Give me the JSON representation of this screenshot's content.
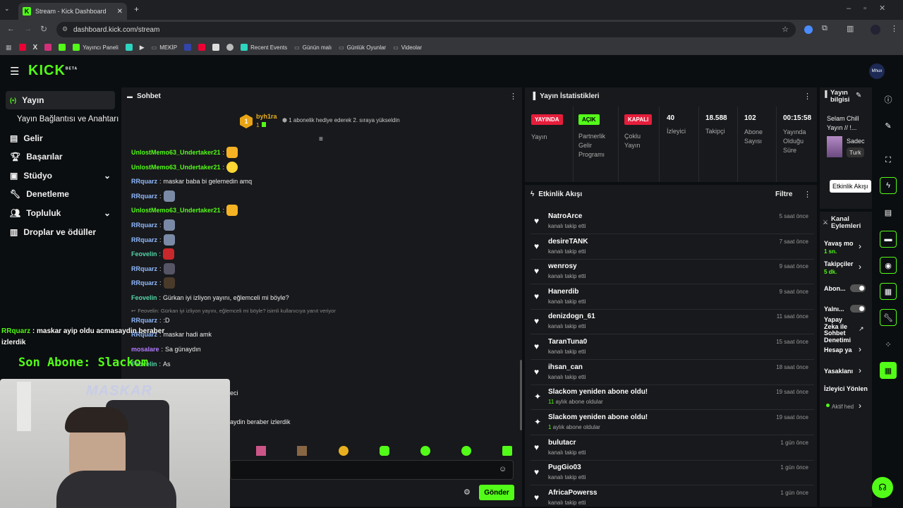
{
  "browser": {
    "tab_title": "Stream - Kick Dashboard",
    "url": "dashboard.kick.com/stream",
    "bookmarks": [
      "Yayıncı Paneli",
      "MEKİP",
      "Recent Events",
      "Günün malı",
      "Günlük Oyunlar",
      "Videolar"
    ]
  },
  "header": {
    "logo": "KICK",
    "logo_sup": "BETA",
    "avatar": "Mhux"
  },
  "sidebar": {
    "items": [
      {
        "label": "Yayın",
        "icon": "broadcast-icon"
      },
      {
        "label": "Yayın Bağlantısı ve Anahtarı",
        "icon": ""
      },
      {
        "label": "Gelir",
        "icon": "chart-icon"
      },
      {
        "label": "Başarılar",
        "icon": "trophy-icon"
      },
      {
        "label": "Stüdyo",
        "icon": "studio-icon"
      },
      {
        "label": "Denetleme",
        "icon": "wrench-icon"
      },
      {
        "label": "Topluluk",
        "icon": "people-icon"
      },
      {
        "label": "Droplar ve ödüller",
        "icon": "gift-icon"
      }
    ]
  },
  "overlay": {
    "chat_line_user": "RRquarz",
    "chat_line_text": " : maskar ayip oldu acmasaydin beraber izlerdik",
    "last_sub": "Son Abone: Slackom",
    "webcam_name": "MASKAR"
  },
  "chat": {
    "title": "Sohbet",
    "pinned_user": "byh1ra",
    "pinned_count": "1",
    "pinned_text": "1 abonelik hediye ederek 2. sıraya yükseldin",
    "messages": [
      {
        "user": "UnlostMemo63_Undertaker21",
        "text": "",
        "color": "green"
      },
      {
        "user": "UnlostMemo63_Undertaker21",
        "text": "",
        "color": "green"
      },
      {
        "user": "RRquarz",
        "text": "maskar baba bi gelemedin amq",
        "color": "blue"
      },
      {
        "user": "RRquarz",
        "text": "",
        "color": "blue"
      },
      {
        "user": "UnlostMemo63_Undertaker21",
        "text": "",
        "color": "green"
      },
      {
        "user": "RRquarz",
        "text": "",
        "color": "blue"
      },
      {
        "user": "RRquarz",
        "text": "",
        "color": "blue"
      },
      {
        "user": "Feovelin",
        "text": "",
        "color": "teal"
      },
      {
        "user": "RRquarz",
        "text": "",
        "color": "blue"
      },
      {
        "user": "RRquarz",
        "text": "",
        "color": "blue"
      },
      {
        "user": "Feovelin",
        "text": "Gürkan iyi izliyon yayını, eğlemceli mi böyle?",
        "color": "teal"
      }
    ],
    "reply_hint": "Feovelin: Gürkan iyi izliyon yayını, eğlemceli mi böyle? isimli kullanıcıya yanıt veriyor",
    "messages2": [
      {
        "user": "RRquarz",
        "text": ":D",
        "color": "blue"
      },
      {
        "user": "RRquarz",
        "text": "maskar hadi amk",
        "color": "blue"
      },
      {
        "user": "mosalare",
        "text": "Sa günaydın",
        "color": "purple"
      },
      {
        "user": "Feovelin",
        "text": "As",
        "color": "teal"
      }
    ],
    "partial1": "eci",
    "partial2": "aydin beraber izlerdik",
    "send_label": "Gönder"
  },
  "stats": {
    "title": "Yayın İstatistikleri",
    "items": [
      {
        "badge": "YAYINDA",
        "label": "Yayın",
        "color": "#e51d3b"
      },
      {
        "badge": "AÇIK",
        "label": "Partnerlik Gelir Programı",
        "color": "#53fc18"
      },
      {
        "badge": "KAPALI",
        "label": "Çoklu Yayın",
        "color": "#e51d3b"
      },
      {
        "value": "40",
        "label": "İzleyici"
      },
      {
        "value": "18.588",
        "label": "Takipçi"
      },
      {
        "value": "102",
        "label": "Abone Sayısı"
      },
      {
        "value": "00:15:58",
        "label": "Yayında Olduğu Süre"
      }
    ]
  },
  "events": {
    "title": "Etkinlik Akışı",
    "filter": "Filtre",
    "items": [
      {
        "name": "NatroArce",
        "sub": "kanalı takip etti",
        "time": "5 saat önce",
        "icon": "heart"
      },
      {
        "name": "desireTANK",
        "sub": "kanalı takip etti",
        "time": "7 saat önce",
        "icon": "heart"
      },
      {
        "name": "wenrosy",
        "sub": "kanalı takip etti",
        "time": "9 saat önce",
        "icon": "heart"
      },
      {
        "name": "Hanerdib",
        "sub": "kanalı takip etti",
        "time": "9 saat önce",
        "icon": "heart"
      },
      {
        "name": "denizdogn_61",
        "sub": "kanalı takip etti",
        "time": "11 saat önce",
        "icon": "heart"
      },
      {
        "name": "TaranTuna0",
        "sub": "kanalı takip etti",
        "time": "15 saat önce",
        "icon": "heart"
      },
      {
        "name": "ihsan_can",
        "sub": "kanalı takip etti",
        "time": "18 saat önce",
        "icon": "heart"
      },
      {
        "name": "Slackom yeniden abone oldu!",
        "sub_num": "11",
        "sub": " aylık abone oldular",
        "time": "19 saat önce",
        "icon": "sparkle"
      },
      {
        "name": "Slackom yeniden abone oldu!",
        "sub_num": "1",
        "sub": " aylık abone oldular",
        "time": "19 saat önce",
        "icon": "sparkle"
      },
      {
        "name": "bulutacr",
        "sub": "kanalı takip etti",
        "time": "1 gün önce",
        "icon": "heart"
      },
      {
        "name": "PugGio03",
        "sub": "kanalı takip etti",
        "time": "1 gün önce",
        "icon": "heart"
      },
      {
        "name": "AfricaPowerss",
        "sub": "kanalı takip etti",
        "time": "1 gün önce",
        "icon": "heart"
      }
    ]
  },
  "info": {
    "title": "Yayın bilgisi",
    "stream_title": "Selam Chill Yayın // !...",
    "category": "Sadec",
    "tag": "Turk"
  },
  "tooltip": "Etkinlik Akışı",
  "actions": {
    "title": "Kanal Eylemleri",
    "slow_label": "Yavaş mo",
    "slow_val": "1 sn.",
    "followers_label": "Takipçiler",
    "followers_val": "5 dk.",
    "subs_label": "Abon...",
    "only_label": "Yalnı...",
    "ai_label": "Yapay Zeka ile Sohbet Denetimi",
    "account_label": "Hesap ya",
    "bans_label": "Yasaklanı",
    "mod_label": "İzleyici Yönlen",
    "active_label": "Aktif hed"
  }
}
